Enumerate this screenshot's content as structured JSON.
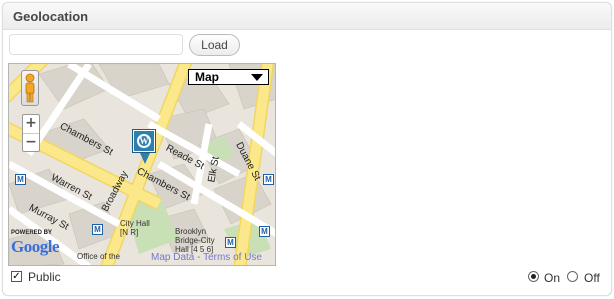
{
  "widget": {
    "title": "Geolocation"
  },
  "address": {
    "value": "",
    "placeholder": ""
  },
  "load_button": "Load",
  "map": {
    "map_type": "Map",
    "zoom_in": "+",
    "zoom_out": "−",
    "streets": [
      "Chambers St",
      "Reade St",
      "Chambers St",
      "Warren St",
      "Murray St",
      "Broadway",
      "Elk St",
      "Duane St"
    ],
    "pois": [
      "City Hall",
      "[N R]",
      "Brooklyn",
      "Bridge-City",
      "Hall [4 5 6]",
      "Office of the"
    ],
    "metro_badge": "M",
    "powered_by": "POWERED BY",
    "google": "Google",
    "map_data": "Map Data",
    "terms": "Terms of Use",
    "terms_separator": " - "
  },
  "public": {
    "label": "Public",
    "checked": true,
    "check_glyph": "✓"
  },
  "radios": {
    "on_label": "On",
    "off_label": "Off",
    "selected": "On"
  },
  "colors": {
    "road": "#fbe88a",
    "block": "#e9e5dc",
    "park": "#c9dfb5",
    "building": "#d8d3ca",
    "accent": "#2e7fb0"
  }
}
